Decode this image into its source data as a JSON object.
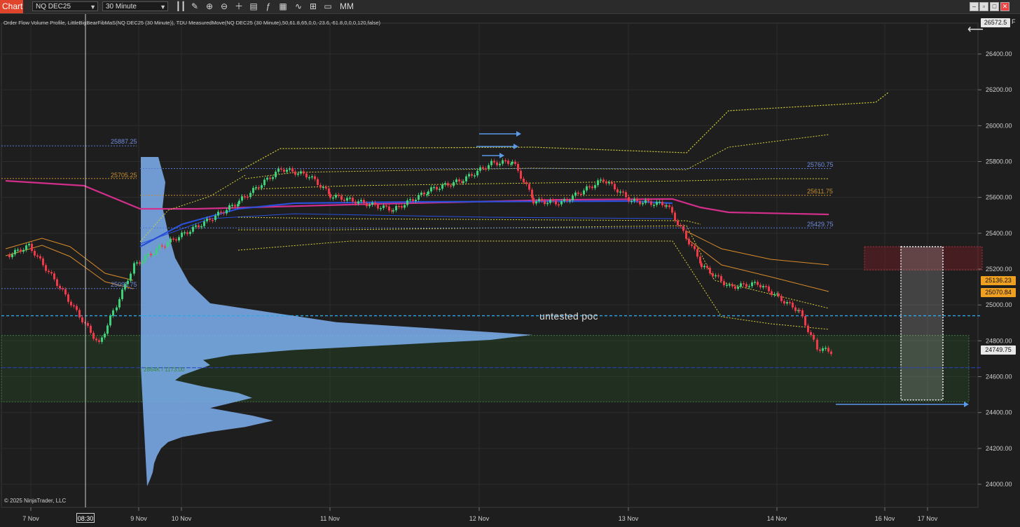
{
  "toolbar": {
    "chart_tab": "Chart",
    "instrument": "NQ DEC25",
    "timeframe": "30 Minute",
    "mm_label": "MM",
    "icons": [
      "bar-type-icon",
      "draw-pencil-icon",
      "zoom-in-icon",
      "zoom-out-icon",
      "crosshair-icon",
      "data-box-icon",
      "indicators-icon",
      "strategies-icon",
      "properties-icon",
      "price-scale-icon"
    ]
  },
  "indicator_text": "Order Flow Volume Profile, LittleBigBearFibMaS(NQ DEC25 (30 Minute)), TDU MeasuredMove(NQ DEC25 (30 Minute),50,61.8,65,0,0,-23.6,-61.8,0,0,0,120,false)",
  "copyright": "© 2025 NinjaTrader, LLC",
  "annotation": "untested poc",
  "profile_label": "↑ 2864K / 1173.00",
  "price_tags": {
    "top": "26572.5",
    "top_suffix": "F",
    "ma_upper": "25136.23",
    "ma_lower": "25070.84",
    "last": "24749.75"
  },
  "cursor_time": "08:30",
  "level_labels": {
    "l1": "25887.25",
    "l2": "25705.25",
    "l3": "25091.75",
    "l4": "25760.75",
    "l5": "25611.75",
    "l6": "25429.75"
  },
  "colors": {
    "up": "#3fd07a",
    "down": "#ef3a4a",
    "profile": "#7eb1f2",
    "poc_line": "#2fa7e8",
    "ma_magenta": "#d12f8a",
    "band_yellow": "#d9d13a",
    "band_orange": "#d98c2a",
    "vwap_blue": "#2a4fd8",
    "zone_green": "#1f3d1f",
    "zone_red": "#5a1e24"
  },
  "chart_data": {
    "type": "candlestick",
    "instrument": "NQ DEC25",
    "interval": "30 Minute",
    "ylim": [
      23800,
      26572.5
    ],
    "yticks": [
      24000,
      24200,
      24400,
      24600,
      24800,
      25000,
      25200,
      25400,
      25600,
      25800,
      26000,
      26200,
      26400
    ],
    "xticks": [
      "7 Nov",
      "9 Nov",
      "10 Nov",
      "11 Nov",
      "12 Nov",
      "13 Nov",
      "14 Nov",
      "16 Nov",
      "17 Nov"
    ],
    "close_path": [
      [
        "7 Nov",
        25280
      ],
      [
        "7 Nov",
        25330
      ],
      [
        "7 Nov",
        25120
      ],
      [
        "7 Nov",
        24780
      ],
      [
        "10 Nov",
        25000
      ],
      [
        "10 Nov",
        25220
      ],
      [
        "10 Nov",
        25330
      ],
      [
        "10 Nov",
        25460
      ],
      [
        "10 Nov",
        25580
      ],
      [
        "11 Nov",
        25760
      ],
      [
        "11 Nov",
        25720
      ],
      [
        "11 Nov",
        25610
      ],
      [
        "11 Nov",
        25530
      ],
      [
        "11 Nov",
        25640
      ],
      [
        "12 Nov",
        25700
      ],
      [
        "12 Nov",
        25790
      ],
      [
        "12 Nov",
        25800
      ],
      [
        "12 Nov",
        25580
      ],
      [
        "13 Nov",
        25570
      ],
      [
        "13 Nov",
        25700
      ],
      [
        "13 Nov",
        25580
      ],
      [
        "13 Nov",
        25560
      ],
      [
        "14 Nov",
        25220
      ],
      [
        "14 Nov",
        25100
      ],
      [
        "14 Nov",
        25120
      ],
      [
        "14 Nov",
        25040
      ],
      [
        "14 Nov",
        24960
      ],
      [
        "14 Nov",
        24760
      ],
      [
        "14 Nov",
        24740
      ]
    ],
    "horizontal_levels": [
      {
        "label": "25887.25",
        "value": 25887.25
      },
      {
        "label": "25705.25",
        "value": 25705.25
      },
      {
        "label": "25091.75",
        "value": 25091.75
      },
      {
        "label": "25760.75",
        "value": 25760.75
      },
      {
        "label": "25611.75",
        "value": 25611.75
      },
      {
        "label": "25429.75",
        "value": 25429.75
      },
      {
        "label": "untested poc",
        "value": 24940
      }
    ],
    "zones": [
      {
        "kind": "support",
        "from": 24460,
        "to": 24830
      },
      {
        "kind": "resistance",
        "from": 25195,
        "to": 25325
      },
      {
        "kind": "measured-move",
        "from": 24470,
        "to": 25325
      }
    ],
    "last_price": 24749.75
  }
}
